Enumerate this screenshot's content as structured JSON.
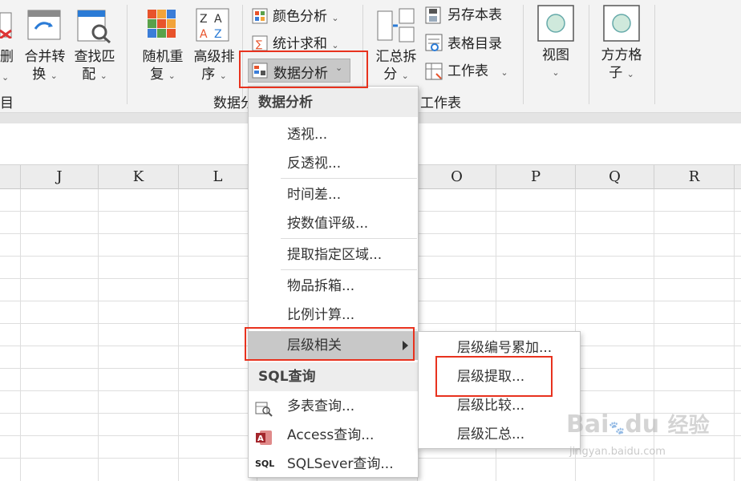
{
  "ribbon": {
    "partial_left_label": "删",
    "partial_left_chevron": "⌄",
    "partial_left_group": "目",
    "merge_convert": {
      "line1": "合并转",
      "line2": "换"
    },
    "find_match": {
      "line1": "查找匹",
      "line2": "配"
    },
    "random_repeat": {
      "line1": "随机重",
      "line2": "复"
    },
    "advanced_sort": {
      "line1": "高级排",
      "line2": "序"
    },
    "color_analysis": "颜色分析",
    "stats_sum": "统计求和",
    "data_analysis": "数据分析",
    "group_data": "数据分",
    "summary_split": {
      "line1": "汇总拆",
      "line2": "分"
    },
    "save_as_table": "另存本表",
    "table_directory": "表格目录",
    "worksheet": "工作表",
    "group_worksheet": "工作表",
    "view": {
      "line1": "视图"
    },
    "square_grid": {
      "line1": "方方格",
      "line2": "子"
    },
    "chevron": "⌄"
  },
  "columns": [
    "J",
    "K",
    "L",
    "O",
    "P",
    "Q",
    "R"
  ],
  "menu": {
    "header_data": "数据分析",
    "pivot": "透视...",
    "unpivot": "反透视...",
    "time_diff": "时间差...",
    "rank_by_value": "按数值评级...",
    "extract_region": "提取指定区域...",
    "item_unbox": "物品拆箱...",
    "ratio_calc": "比例计算...",
    "level_related": "层级相关",
    "header_sql": "SQL查询",
    "multi_table": "多表查询...",
    "access_query": "Access查询...",
    "sqlserver_query": "SQLSever查询...",
    "sql_icon_text": "SQL"
  },
  "submenu": {
    "level_number_add": "层级编号累加...",
    "level_extract": "层级提取...",
    "level_compare": "层级比较...",
    "level_summary": "层级汇总..."
  },
  "watermark": {
    "logo": "Bai",
    "paw_text": "du",
    "cn": "经验",
    "url": "jingyan.baidu.com"
  },
  "colors": {
    "highlight_red": "#e8321e",
    "menu_hover": "#c8c8c8"
  }
}
